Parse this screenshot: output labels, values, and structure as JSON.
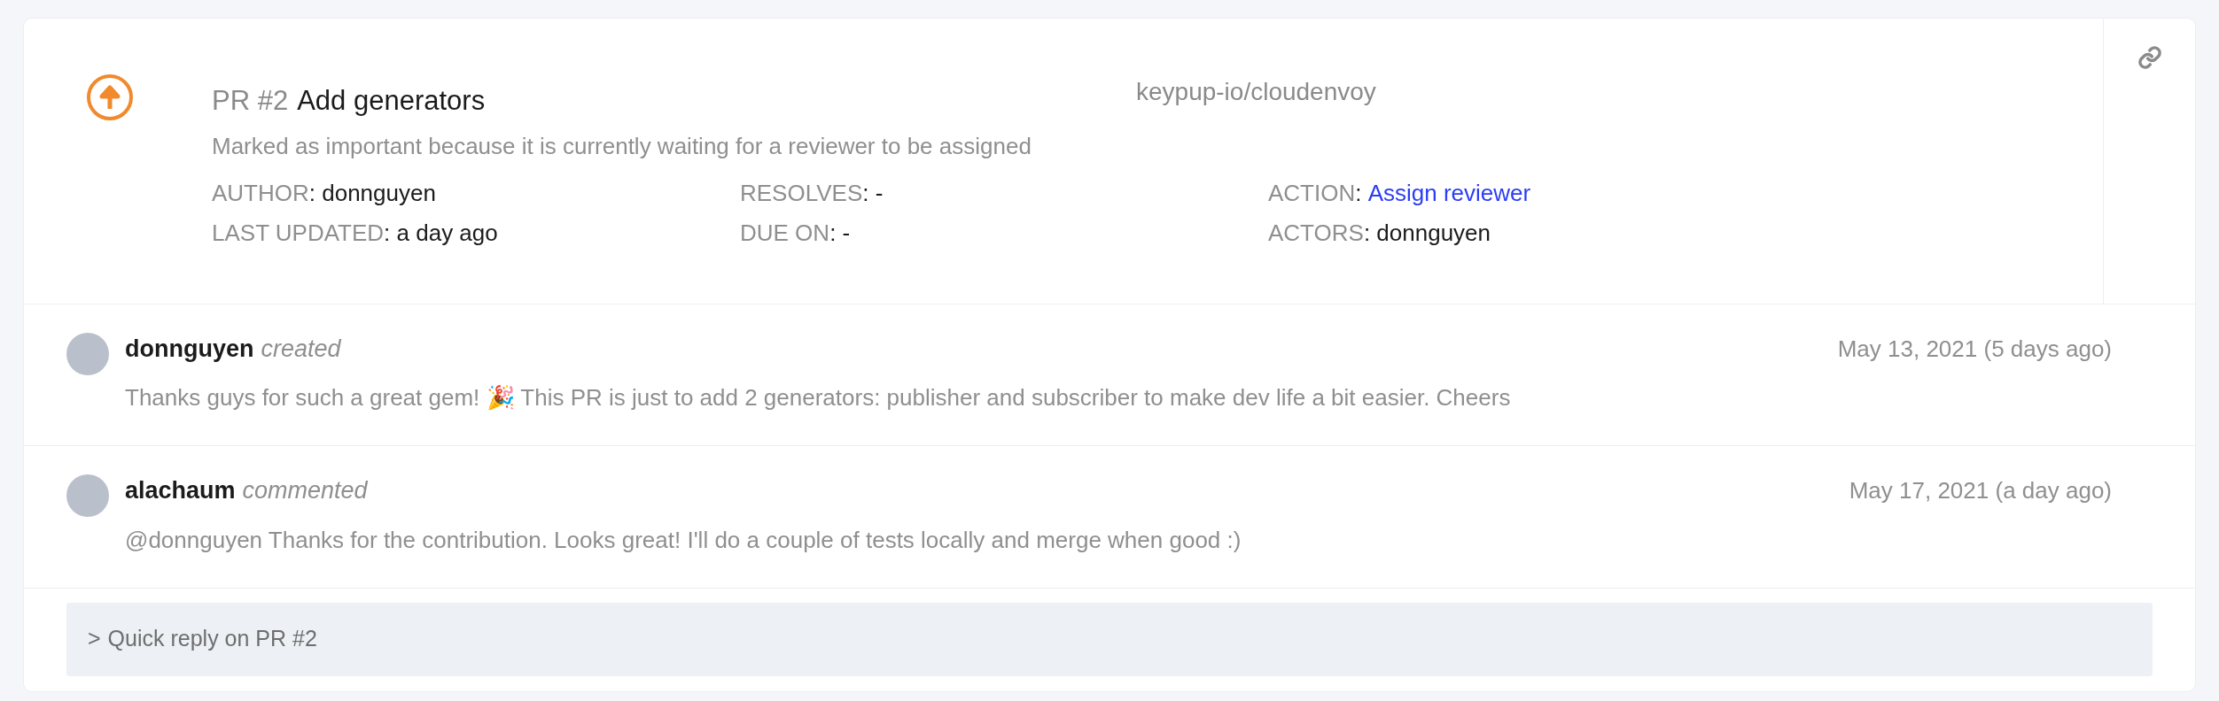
{
  "item": {
    "pr_number": "PR #2",
    "title": "Add generators",
    "repository": "keypup-io/cloudenvoy",
    "reason": "Marked as important because it is currently waiting for a reviewer to be assigned",
    "meta": [
      [
        {
          "label": "AUTHOR",
          "sep": ": ",
          "value": "donnguyen",
          "kind": "text"
        },
        {
          "label": "RESOLVES",
          "sep": ": ",
          "value": "-",
          "kind": "text"
        },
        {
          "label": "ACTION",
          "sep": ": ",
          "value": "Assign reviewer",
          "kind": "link"
        }
      ],
      [
        {
          "label": "LAST UPDATED",
          "sep": ": ",
          "value": "a day ago",
          "kind": "text"
        },
        {
          "label": "DUE ON",
          "sep": ": ",
          "value": "-",
          "kind": "text"
        },
        {
          "label": "ACTORS",
          "sep": ": ",
          "value": "donnguyen",
          "kind": "text"
        }
      ]
    ]
  },
  "comments": [
    {
      "author": "donnguyen",
      "verb": "created",
      "date": "May 13, 2021 (5 days ago)",
      "body": "Thanks guys for such a great gem! 🎉 This PR is just to add 2 generators: publisher and subscriber to make dev life a bit easier. Cheers"
    },
    {
      "author": "alachaum",
      "verb": "commented",
      "date": "May 17, 2021 (a day ago)",
      "body": "@donnguyen Thanks for the contribution. Looks great! I'll do a couple of tests locally and merge when good :)"
    }
  ],
  "quick_reply": {
    "caret": ">",
    "label": "Quick reply on PR #2"
  }
}
